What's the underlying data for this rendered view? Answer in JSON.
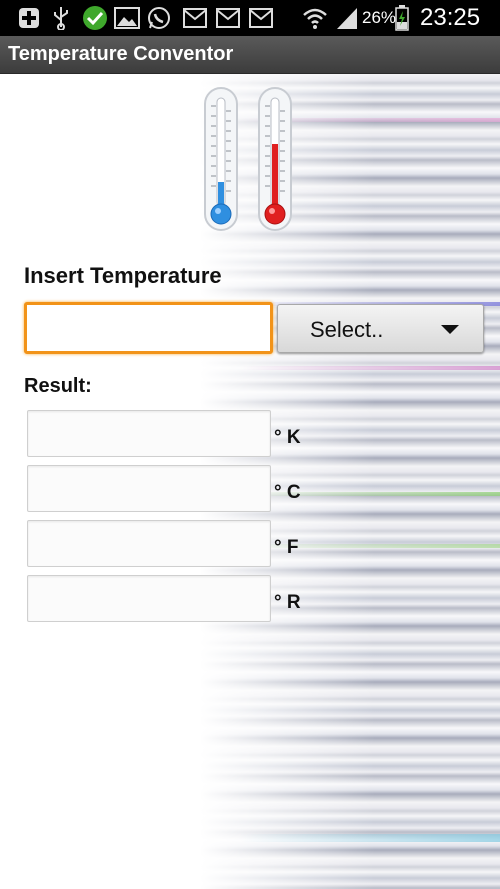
{
  "status_bar": {
    "battery": "26%",
    "time": "23:25",
    "icons": [
      "add-icon",
      "usb-icon",
      "check-icon",
      "image-icon",
      "whatsapp-icon",
      "gmail-icon",
      "gmail-icon",
      "gmail-icon",
      "wifi-icon",
      "signal-icon",
      "battery-icon"
    ]
  },
  "app": {
    "title": "Temperature Conventor"
  },
  "form": {
    "insert_label": "Insert Temperature",
    "input_value": "",
    "select_value": "Select..",
    "result_label": "Result:"
  },
  "results": [
    {
      "unit": "° K",
      "value": ""
    },
    {
      "unit": "° C",
      "value": ""
    },
    {
      "unit": "° F",
      "value": ""
    },
    {
      "unit": "° R",
      "value": ""
    }
  ],
  "colors": {
    "accent_focus": "#f29318",
    "cold_thermometer": "#2f8fe0",
    "hot_thermometer": "#e02020"
  }
}
